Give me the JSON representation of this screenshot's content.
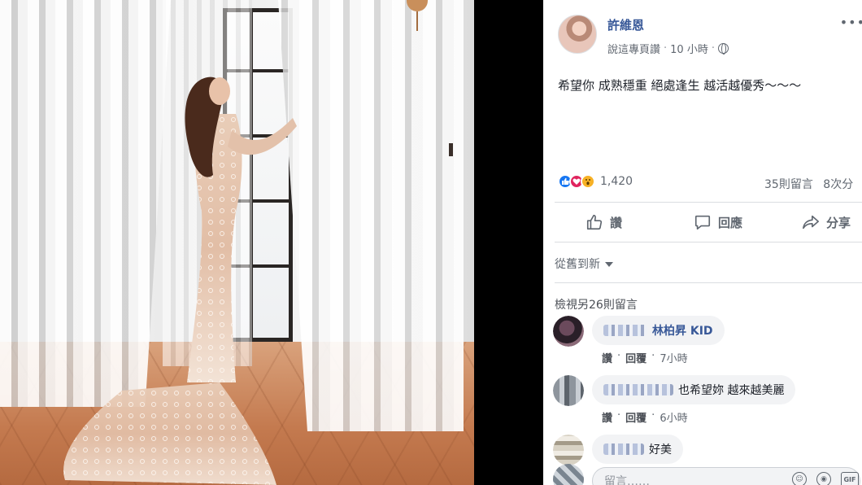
{
  "post": {
    "author": "許維恩",
    "meta_liked": "說這專頁讚",
    "meta_time": "10 小時",
    "meta_sep": "·",
    "text": "希望你 成熟穩重 絕處逢生 越活越優秀～～～",
    "reaction_count": "1,420",
    "comment_count": "35則留言",
    "share_count": "8次分",
    "icons": [
      "globe-icon",
      "more-icon",
      "like-icon",
      "comment-icon",
      "share-icon"
    ]
  },
  "actions": {
    "like": "讚",
    "comment": "回應",
    "share": "分享"
  },
  "sort": {
    "label": "從舊到新"
  },
  "view_more": "檢視另26則留言",
  "comments": [
    {
      "name": "林柏昇 KID",
      "text": "",
      "like": "讚",
      "reply": "回覆",
      "time": "7小時",
      "dot": "·"
    },
    {
      "name": "",
      "text": "也希望妳 越來越美麗",
      "like": "讚",
      "reply": "回覆",
      "time": "6小時",
      "dot": "·"
    },
    {
      "name": "",
      "text": "好美",
      "like": "",
      "reply": "",
      "time": "",
      "dot": ""
    }
  ],
  "comment_box": {
    "placeholder": "留言……"
  },
  "colors": {
    "link": "#385898",
    "like_blue": "#1877f2",
    "love_red": "#e0245e",
    "wow_yellow": "#f7b125"
  }
}
